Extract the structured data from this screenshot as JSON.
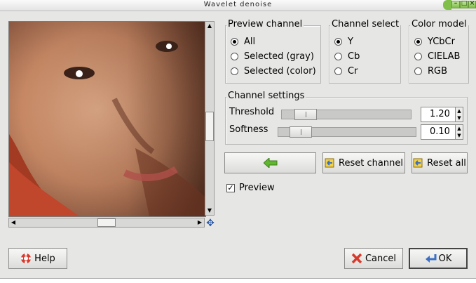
{
  "window": {
    "title": "Wavelet denoise"
  },
  "preview_channel": {
    "legend": "Preview channel",
    "options": [
      "All",
      "Selected (gray)",
      "Selected (color)"
    ],
    "selected": "All"
  },
  "channel_select": {
    "legend": "Channel select",
    "options": [
      "Y",
      "Cb",
      "Cr"
    ],
    "selected": "Y"
  },
  "color_model": {
    "legend": "Color model",
    "options": [
      "YCbCr",
      "CIELAB",
      "RGB"
    ],
    "selected": "YCbCr"
  },
  "channel_settings": {
    "legend": "Channel settings",
    "threshold": {
      "label": "Threshold",
      "value": "1.20",
      "fraction": 0.12
    },
    "softness": {
      "label": "Softness",
      "value": "0.10",
      "fraction": 0.1
    }
  },
  "actions": {
    "reset_channel": "Reset channel",
    "reset_all": "Reset all"
  },
  "preview_toggle": {
    "label": "Preview",
    "checked": true
  },
  "footer": {
    "help": "Help",
    "cancel": "Cancel",
    "ok": "OK"
  },
  "colors": {
    "accent_green": "#7fbf4a",
    "arrow_green": "#5fb82e",
    "ok_blue": "#3a6fc4"
  }
}
